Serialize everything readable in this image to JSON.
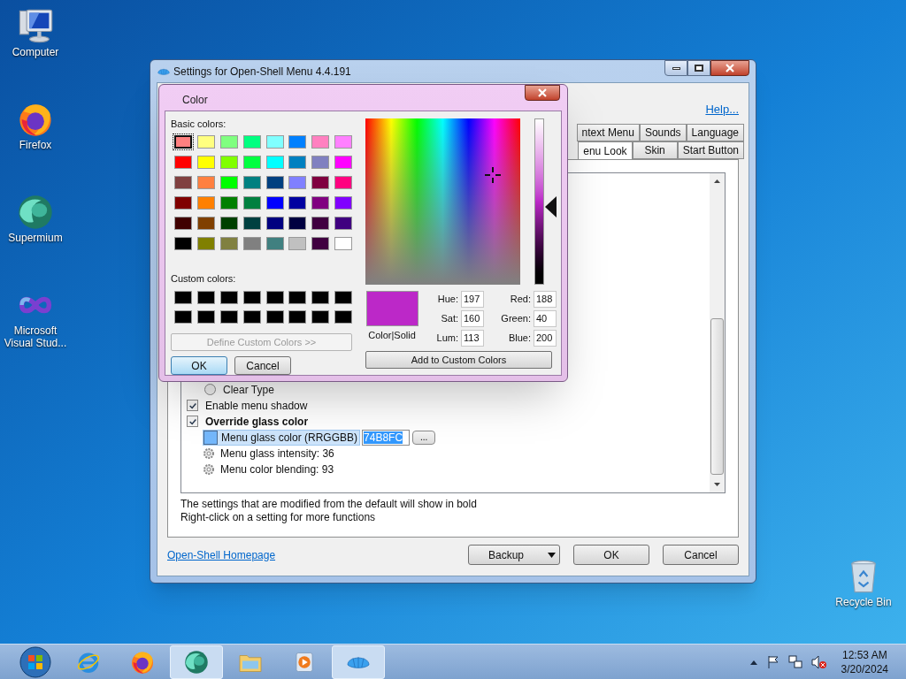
{
  "desktop_icons": [
    {
      "label": "Computer",
      "kind": "computer"
    },
    {
      "label": "Firefox",
      "kind": "firefox"
    },
    {
      "label": "Supermium",
      "kind": "supermium"
    },
    {
      "label": "Microsoft Visual Stud...",
      "kind": "visualstudio"
    }
  ],
  "recycle_bin": {
    "label": "Recycle Bin"
  },
  "settings_window": {
    "title": "Settings for Open-Shell Menu 4.4.191",
    "help_link": "Help...",
    "tab_rows": [
      [
        {
          "label": "ntext Menu",
          "selected": false
        },
        {
          "label": "Sounds",
          "selected": false
        },
        {
          "label": "Language",
          "selected": false
        }
      ],
      [
        {
          "label": "enu Look",
          "selected": true
        },
        {
          "label": "Skin",
          "selected": false
        },
        {
          "label": "Start Button",
          "selected": false
        }
      ]
    ],
    "settings": [
      {
        "kind": "radio",
        "label": "Clear Type",
        "checked": false,
        "modified": false
      },
      {
        "kind": "checkbox",
        "label": "Enable menu shadow",
        "checked": true,
        "modified": false
      },
      {
        "kind": "checkbox",
        "label": "Override glass color",
        "checked": true,
        "modified": true,
        "children": [
          {
            "kind": "color",
            "label": "Menu glass color (RRGGBB)",
            "value": "74B8FC",
            "color": "#74b8fc",
            "browse": "...",
            "modified": false
          },
          {
            "kind": "value",
            "label": "Menu glass intensity: 36",
            "modified": false
          },
          {
            "kind": "value",
            "label": "Menu color blending: 93",
            "modified": false
          }
        ]
      }
    ],
    "notes": [
      "The settings that are modified from the default will show in bold",
      "Right-click on a setting for more functions"
    ],
    "homepage_link": "Open-Shell Homepage",
    "buttons": [
      {
        "label": "Backup",
        "kind": "dropdown"
      },
      {
        "label": "OK",
        "kind": "plain"
      },
      {
        "label": "Cancel",
        "kind": "plain"
      }
    ]
  },
  "color_dialog": {
    "title": "Color",
    "basic_label": "Basic colors:",
    "basic_colors": [
      {
        "color": "#ff8080",
        "selected": true
      },
      {
        "color": "#ffff80",
        "selected": false
      },
      {
        "color": "#80ff80",
        "selected": false
      },
      {
        "color": "#00ff80",
        "selected": false
      },
      {
        "color": "#80ffff",
        "selected": false
      },
      {
        "color": "#0080ff",
        "selected": false
      },
      {
        "color": "#ff80c0",
        "selected": false
      },
      {
        "color": "#ff80ff",
        "selected": false
      },
      {
        "color": "#ff0000",
        "selected": false
      },
      {
        "color": "#ffff00",
        "selected": false
      },
      {
        "color": "#80ff00",
        "selected": false
      },
      {
        "color": "#00ff40",
        "selected": false
      },
      {
        "color": "#00ffff",
        "selected": false
      },
      {
        "color": "#0080c0",
        "selected": false
      },
      {
        "color": "#8080c0",
        "selected": false
      },
      {
        "color": "#ff00ff",
        "selected": false
      },
      {
        "color": "#804040",
        "selected": false
      },
      {
        "color": "#ff8040",
        "selected": false
      },
      {
        "color": "#00ff00",
        "selected": false
      },
      {
        "color": "#008080",
        "selected": false
      },
      {
        "color": "#004080",
        "selected": false
      },
      {
        "color": "#8080ff",
        "selected": false
      },
      {
        "color": "#800040",
        "selected": false
      },
      {
        "color": "#ff0080",
        "selected": false
      },
      {
        "color": "#800000",
        "selected": false
      },
      {
        "color": "#ff8000",
        "selected": false
      },
      {
        "color": "#008000",
        "selected": false
      },
      {
        "color": "#008040",
        "selected": false
      },
      {
        "color": "#0000ff",
        "selected": false
      },
      {
        "color": "#0000a0",
        "selected": false
      },
      {
        "color": "#800080",
        "selected": false
      },
      {
        "color": "#8000ff",
        "selected": false
      },
      {
        "color": "#400000",
        "selected": false
      },
      {
        "color": "#804000",
        "selected": false
      },
      {
        "color": "#004000",
        "selected": false
      },
      {
        "color": "#004040",
        "selected": false
      },
      {
        "color": "#000080",
        "selected": false
      },
      {
        "color": "#000040",
        "selected": false
      },
      {
        "color": "#400040",
        "selected": false
      },
      {
        "color": "#400080",
        "selected": false
      },
      {
        "color": "#000000",
        "selected": false
      },
      {
        "color": "#808000",
        "selected": false
      },
      {
        "color": "#808040",
        "selected": false
      },
      {
        "color": "#808080",
        "selected": false
      },
      {
        "color": "#408080",
        "selected": false
      },
      {
        "color": "#c0c0c0",
        "selected": false
      },
      {
        "color": "#400040",
        "selected": false
      },
      {
        "color": "#ffffff",
        "selected": false
      }
    ],
    "custom_label": "Custom colors:",
    "custom_colors": [
      {
        "color": "#000000"
      },
      {
        "color": "#000000"
      },
      {
        "color": "#000000"
      },
      {
        "color": "#000000"
      },
      {
        "color": "#000000"
      },
      {
        "color": "#000000"
      },
      {
        "color": "#000000"
      },
      {
        "color": "#000000"
      },
      {
        "color": "#000000"
      },
      {
        "color": "#000000"
      },
      {
        "color": "#000000"
      },
      {
        "color": "#000000"
      },
      {
        "color": "#000000"
      },
      {
        "color": "#000000"
      },
      {
        "color": "#000000"
      },
      {
        "color": "#000000"
      }
    ],
    "define_button": {
      "label": "Define Custom Colors >>",
      "disabled": true
    },
    "buttons": [
      {
        "label": "OK",
        "default": true
      },
      {
        "label": "Cancel",
        "default": false
      }
    ],
    "luminance": {
      "level": 0.47
    },
    "preview": {
      "color": "#bc28c8",
      "label": "Color|Solid"
    },
    "hsl_fields": [
      {
        "label": "Hue:",
        "value": "197"
      },
      {
        "label": "Sat:",
        "value": "160"
      },
      {
        "label": "Lum:",
        "value": "113"
      }
    ],
    "rgb_fields": [
      {
        "label": "Red:",
        "value": "188"
      },
      {
        "label": "Green:",
        "value": "40"
      },
      {
        "label": "Blue:",
        "value": "200"
      }
    ],
    "add_button": "Add to Custom Colors"
  },
  "taskbar": {
    "items": [
      {
        "kind": "ie",
        "active": false
      },
      {
        "kind": "firefox",
        "active": false
      },
      {
        "kind": "supermium",
        "active": true
      },
      {
        "kind": "explorer",
        "active": false
      },
      {
        "kind": "media",
        "active": false
      },
      {
        "kind": "shell",
        "active": true
      }
    ],
    "clock_time": "12:53 AM",
    "clock_date": "3/20/2024"
  }
}
